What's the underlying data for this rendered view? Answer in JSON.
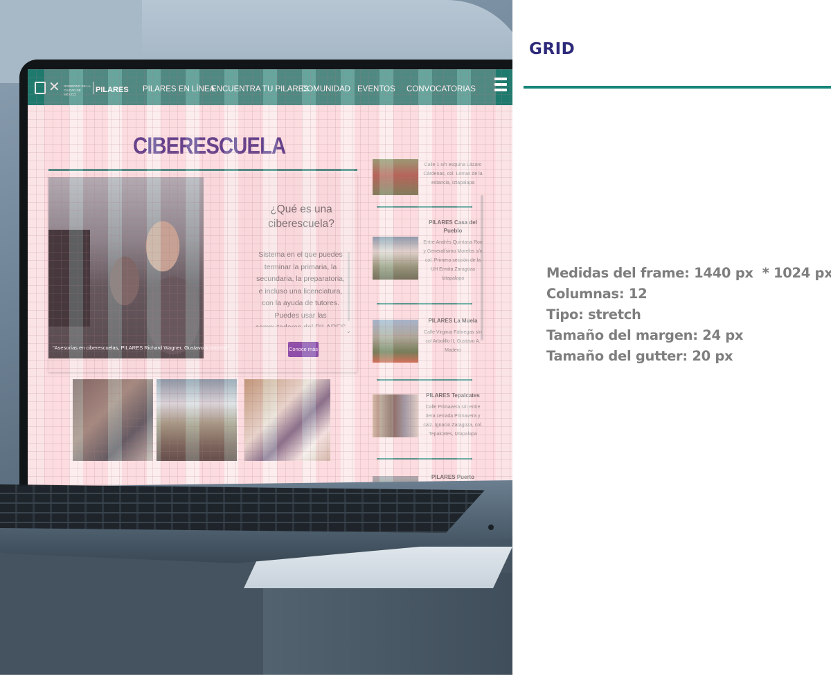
{
  "panel": {
    "heading": "GRID",
    "specs": [
      "Medidas del frame: 1440 px  * 1024 px",
      "Columnas: 12",
      "Tipo: stretch",
      "Tamaño del margen: 24 px",
      "Tamaño del gutter: 20 px"
    ]
  },
  "colors": {
    "heading": "#2e2a7a",
    "accent_rule": "#15857a",
    "nav_bg": "#1f7a6e",
    "title": "#3a1d7a",
    "cta_bg": "#6f2fa0"
  },
  "site": {
    "gov_label": "GOBIERNO DE LA CIUDAD DE MÉXICO",
    "brand": "PILARES",
    "nav": [
      "PILARES EN LÍNEA",
      "ENCUENTRA TU PILARES",
      "COMUNIDAD",
      "EVENTOS",
      "CONVOCATORIAS"
    ],
    "menu_icon": "hamburger-icon",
    "page_title": "CIBERESCUELA",
    "caption": "\"Asesorías en ciberescuelas, PILARES Richard Wagner, Gustavo A Madero\"",
    "question_title": "¿Qué es una ciberescuela?",
    "question_body": "Sistema en el que puedes terminar la primaria, la secundaria, la preparatoria, e incluso una licenciatura, con la ayuda de tutores. Puedes usar las computadoras del PILARES y",
    "cta": "Conoce más",
    "locations": [
      {
        "name": "",
        "address": "Calle 1 s/n esquina Lázaro Cárdenas, col. Lomas de la estancia, Iztapalapa"
      },
      {
        "name": "PILARES Casa del Pueblo",
        "address": "Entre Andrés Quintana Roo y Generalísimo Morelos s/n col. Primera sección de la UH Ermita Zaragoza Iztapalapa"
      },
      {
        "name": "PILARES La Muela",
        "address": "Calle Virginia Fábregas s/n col Arbolillo II, Gustavo A. Madero"
      },
      {
        "name": "PILARES Tepalcates",
        "address": "Calle Primavera s/n entre 3era cerrada Primavera y calz. Ignacio Zaragoza, col. Tepalcates, Iztapalapa"
      },
      {
        "name": "PILARES Puerto Mazatlán",
        "address": ""
      }
    ]
  }
}
